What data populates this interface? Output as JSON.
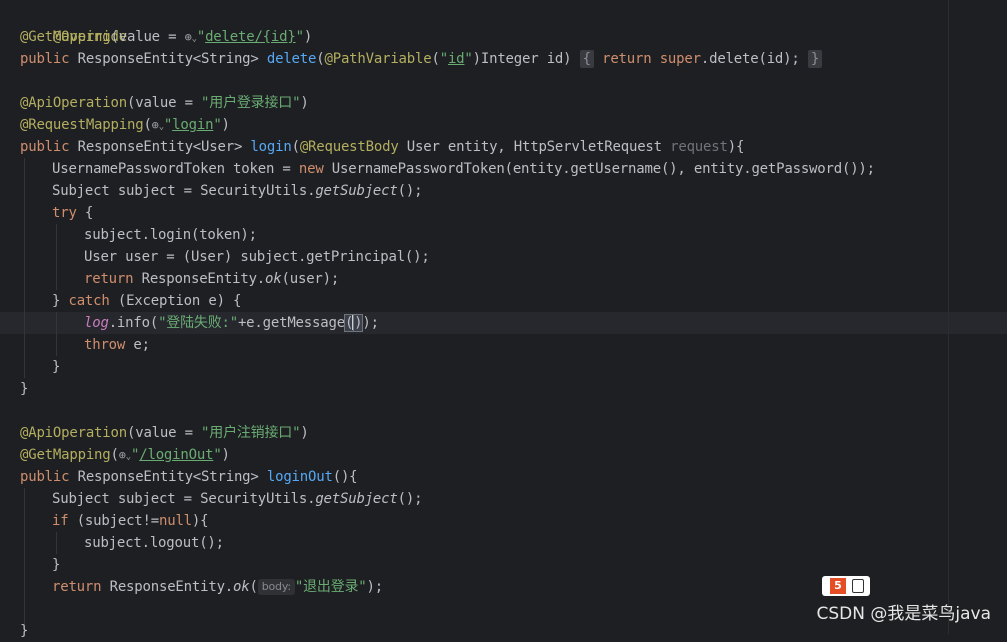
{
  "code": {
    "l01": {
      "ann": "@Override"
    },
    "l02": {
      "ann": "@GetMapping",
      "a": "(value = ",
      "globe": "⊕",
      "chev": "⌄",
      "s1": "\"",
      "url": "delete/{id}",
      "s2": "\"",
      "b": ")"
    },
    "l03": {
      "kw": "public",
      "a": " ResponseEntity<String> ",
      "fn": "delete",
      "b": "(",
      "ann": "@PathVariable",
      "c": "(",
      "s1": "\"",
      "url": "id",
      "s2": "\"",
      "d": ")Integer id)",
      "fold1": "{",
      "kw2": "return",
      "kw3": "super",
      "e": ".delete(id);",
      "fold2": "}"
    },
    "l05": {
      "ann": "@ApiOperation",
      "a": "(value = ",
      "str": "\"用户登录接口\"",
      "b": ")"
    },
    "l06": {
      "ann": "@RequestMapping",
      "a": "(",
      "globe": "⊕",
      "chev": "⌄",
      "s1": "\"",
      "url": "login",
      "s2": "\"",
      "b": ")"
    },
    "l07": {
      "kw": "public",
      "a": " ResponseEntity<User> ",
      "fn": "login",
      "b": "(",
      "ann": "@RequestBody",
      "c": " User entity, HttpServletRequest ",
      "gray": "request",
      "d": "){"
    },
    "l08": {
      "a": "UsernamePasswordToken token = ",
      "kw": "new",
      "b": " UsernamePasswordToken(entity.getUsername(), entity.getPassword());"
    },
    "l09": {
      "a": "Subject subject = SecurityUtils.",
      "it": "getSubject",
      "b": "();"
    },
    "l10": {
      "kw": "try",
      "a": " {"
    },
    "l11": {
      "a": "subject.login(token);"
    },
    "l12": {
      "a": "User user = (User) subject.getPrincipal();"
    },
    "l13": {
      "kw": "return",
      "a": " ResponseEntity.",
      "it": "ok",
      "b": "(user);"
    },
    "l14": {
      "a": "} ",
      "kw": "catch",
      "b": " (Exception e) {"
    },
    "l15": {
      "field": "log",
      "a": ".info(",
      "str": "\"登陆失败:\"",
      "b": "+e.getMessage",
      "p1": "(",
      "p2": ")",
      "c": ");"
    },
    "l16": {
      "kw": "throw",
      "a": " e;"
    },
    "l17": {
      "a": "}"
    },
    "l18": {
      "a": "}"
    },
    "l20": {
      "ann": "@ApiOperation",
      "a": "(value = ",
      "str": "\"用户注销接口\"",
      "b": ")"
    },
    "l21": {
      "ann": "@GetMapping",
      "a": "(",
      "globe": "⊕",
      "chev": "⌄",
      "s1": "\"",
      "url": "/loginOut",
      "s2": "\"",
      "b": ")"
    },
    "l22": {
      "kw": "public",
      "a": " ResponseEntity<String> ",
      "fn": "loginOut",
      "b": "(){"
    },
    "l23": {
      "a": "Subject subject = SecurityUtils.",
      "it": "getSubject",
      "b": "();"
    },
    "l24": {
      "kw": "if",
      "a": " (subject!=",
      "kw2": "null",
      "b": "){"
    },
    "l25": {
      "a": "subject.logout();"
    },
    "l26": {
      "a": "}"
    },
    "l27": {
      "kw": "return",
      "a": " ResponseEntity.",
      "it": "ok",
      "b": "(",
      "hint": "body:",
      "str": "\"退出登录\"",
      "c": ");"
    },
    "l29": {
      "a": "}"
    }
  },
  "watermark": "CSDN @我是菜鸟java",
  "badge": {
    "label": "5"
  }
}
